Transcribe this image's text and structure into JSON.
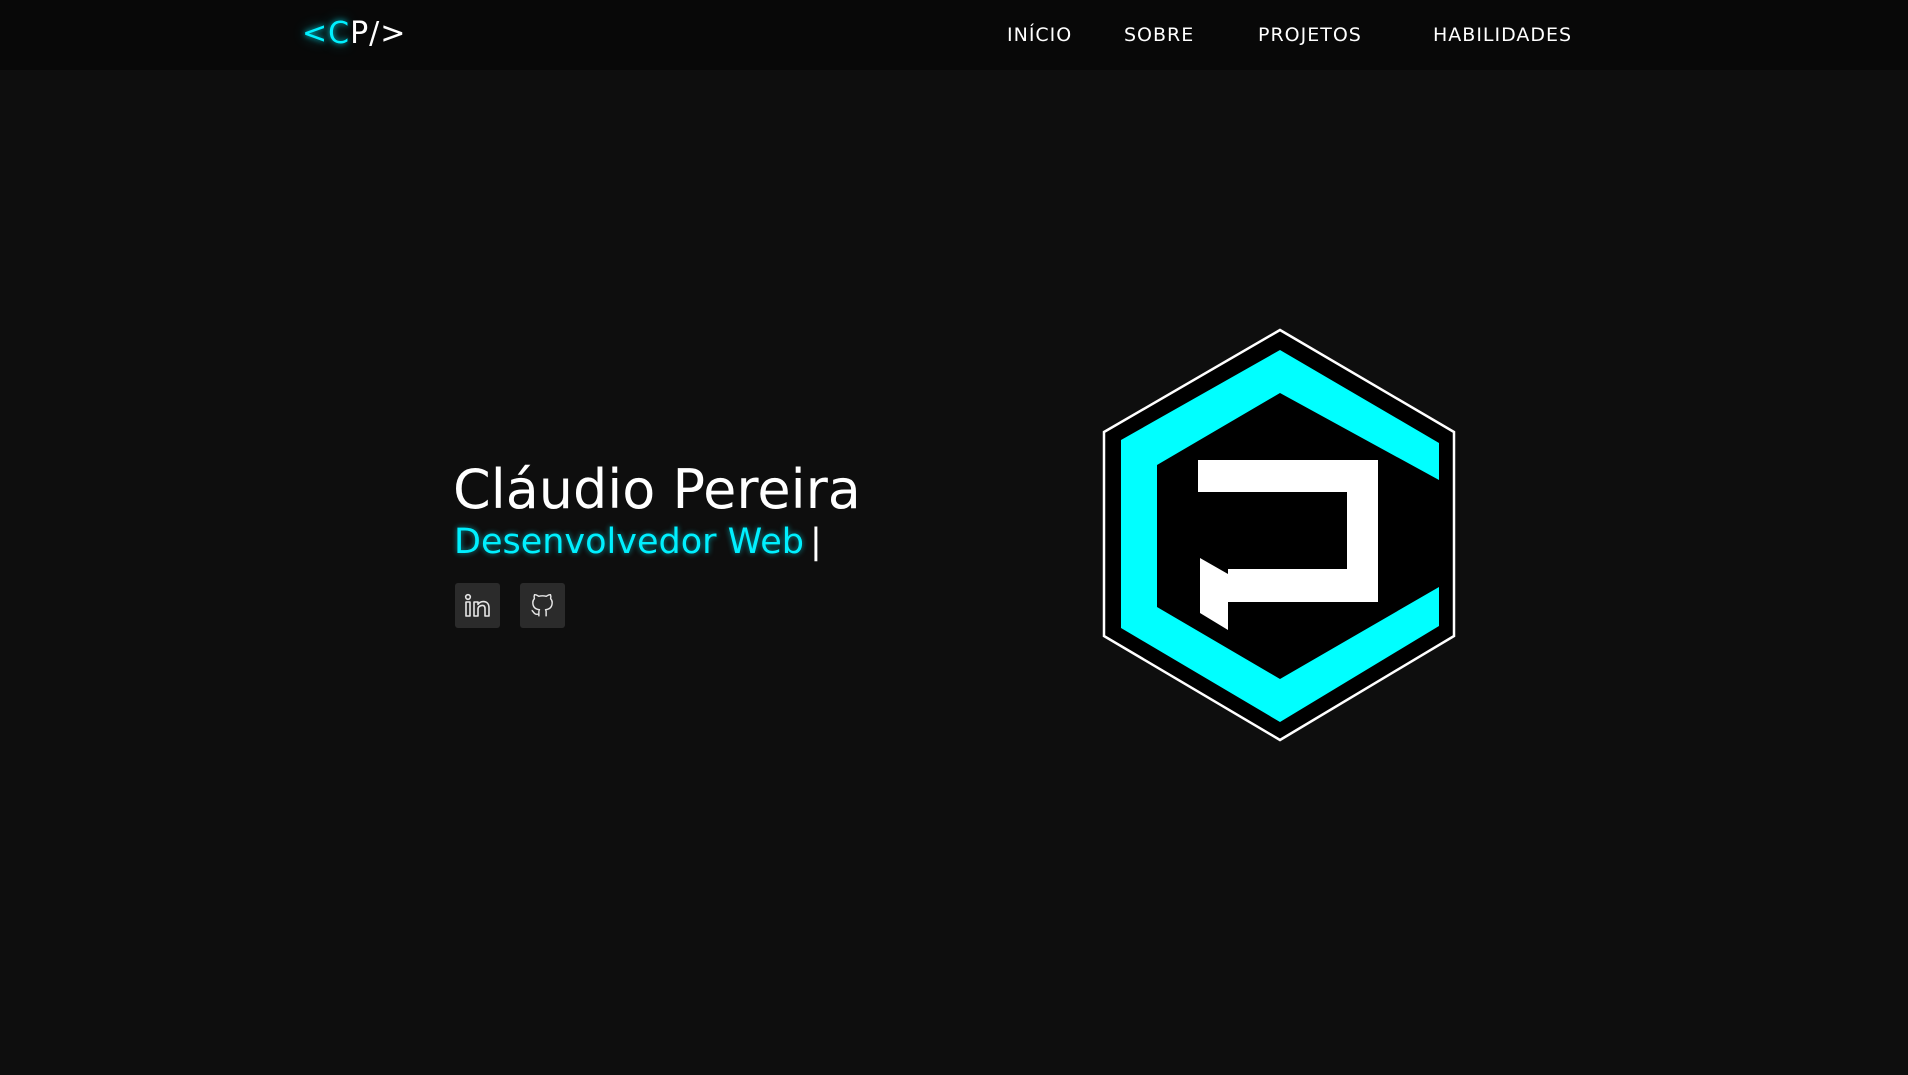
{
  "navbar": {
    "logo": {
      "open_bracket": "<",
      "letter_c": "C",
      "rest": "P/>"
    },
    "links": [
      {
        "label": "INÍCIO"
      },
      {
        "label": "SOBRE"
      },
      {
        "label": "PROJETOS"
      },
      {
        "label": "HABILIDADES"
      }
    ]
  },
  "hero": {
    "name": "Cláudio Pereira",
    "role": "Desenvolvedor Web",
    "cursor": "|",
    "social": [
      {
        "icon": "linkedin-icon"
      },
      {
        "icon": "github-icon"
      }
    ]
  },
  "colors": {
    "background": "#0e0e0e",
    "navbar": "#080808",
    "accent": "#00f0ff",
    "text": "#ffffff",
    "social_button": "#2b2b2b"
  }
}
